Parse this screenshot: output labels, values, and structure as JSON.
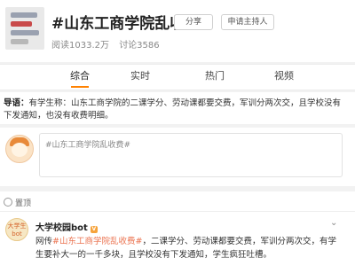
{
  "header": {
    "title": "#山东工商学院乱收费#",
    "read": "阅读1033.2万",
    "discuss": "讨论3586",
    "share_label": "分享",
    "host_label": "申请主持人"
  },
  "tabs": [
    "综合",
    "实时",
    "热门",
    "视频"
  ],
  "guide": {
    "prefix": "导语：",
    "text": "有学生称：山东工商学院的二课学分、劳动课都要交费，军训分两次交，且学校没有下发通知，也没有收费明细。"
  },
  "compose": {
    "placeholder": "#山东工商学院乱收费#"
  },
  "pinned": {
    "label": "置顶",
    "badge_line1": "大学生",
    "badge_line2": "bot",
    "author": "大学校园bot",
    "text_prefix": "网传",
    "text_topic": "#山东工商学院乱收费#",
    "text_rest": "，二课学分、劳动课都要交费，军训分两次交，有学生要补大一的一千多块，且学校没有下发通知，学生疯狂吐槽。"
  },
  "colors": {
    "accent": "#ff8200",
    "topic": "#eb7350"
  }
}
